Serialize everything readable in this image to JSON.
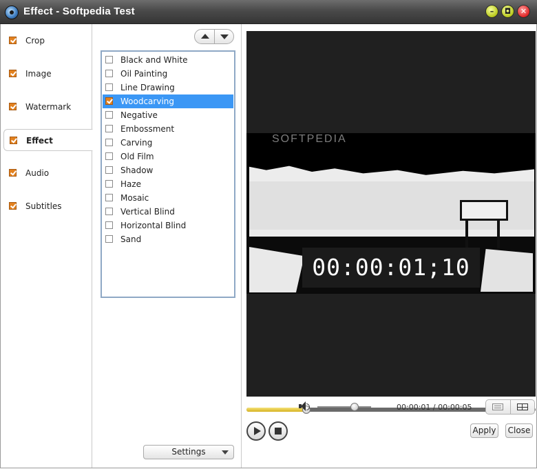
{
  "window": {
    "title": "Effect - Softpedia Test",
    "app_icon": "film-reel-icon",
    "controls": [
      "minimize-icon",
      "maximize-icon",
      "close-icon"
    ],
    "control_glyphs": {
      "minimize": "–",
      "maximize": "◘",
      "close": "✕"
    }
  },
  "nav": {
    "items": [
      {
        "label": "Crop",
        "checked": true,
        "active": false
      },
      {
        "label": "Image",
        "checked": true,
        "active": false
      },
      {
        "label": "Watermark",
        "checked": true,
        "active": false
      },
      {
        "label": "Effect",
        "checked": true,
        "active": true
      },
      {
        "label": "Audio",
        "checked": true,
        "active": false
      },
      {
        "label": "Subtitles",
        "checked": true,
        "active": false
      }
    ]
  },
  "effects": {
    "items": [
      {
        "label": "Black and White",
        "checked": false,
        "selected": false
      },
      {
        "label": "Oil Painting",
        "checked": false,
        "selected": false
      },
      {
        "label": "Line Drawing",
        "checked": false,
        "selected": false
      },
      {
        "label": "Woodcarving",
        "checked": true,
        "selected": true
      },
      {
        "label": "Negative",
        "checked": false,
        "selected": false
      },
      {
        "label": "Embossment",
        "checked": false,
        "selected": false
      },
      {
        "label": "Carving",
        "checked": false,
        "selected": false
      },
      {
        "label": "Old Film",
        "checked": false,
        "selected": false
      },
      {
        "label": "Shadow",
        "checked": false,
        "selected": false
      },
      {
        "label": "Haze",
        "checked": false,
        "selected": false
      },
      {
        "label": "Mosaic",
        "checked": false,
        "selected": false
      },
      {
        "label": "Vertical Blind",
        "checked": false,
        "selected": false
      },
      {
        "label": "Horizontal Blind",
        "checked": false,
        "selected": false
      },
      {
        "label": "Sand",
        "checked": false,
        "selected": false
      }
    ],
    "settings_label": "Settings"
  },
  "preview": {
    "timecode": "00:00:01;10",
    "watermark": "SOFTPEDIA"
  },
  "player": {
    "seek_progress": 0.205,
    "volume_level": 0.68,
    "current_time": "00:00:01",
    "total_time": "00:00:05",
    "time_separator": " / "
  },
  "footer": {
    "apply_label": "Apply",
    "close_label": "Close"
  },
  "colors": {
    "accent_selection": "#3b97f5",
    "checkbox_checked": "#e2811f",
    "seek_fill": "#d6b21f"
  }
}
